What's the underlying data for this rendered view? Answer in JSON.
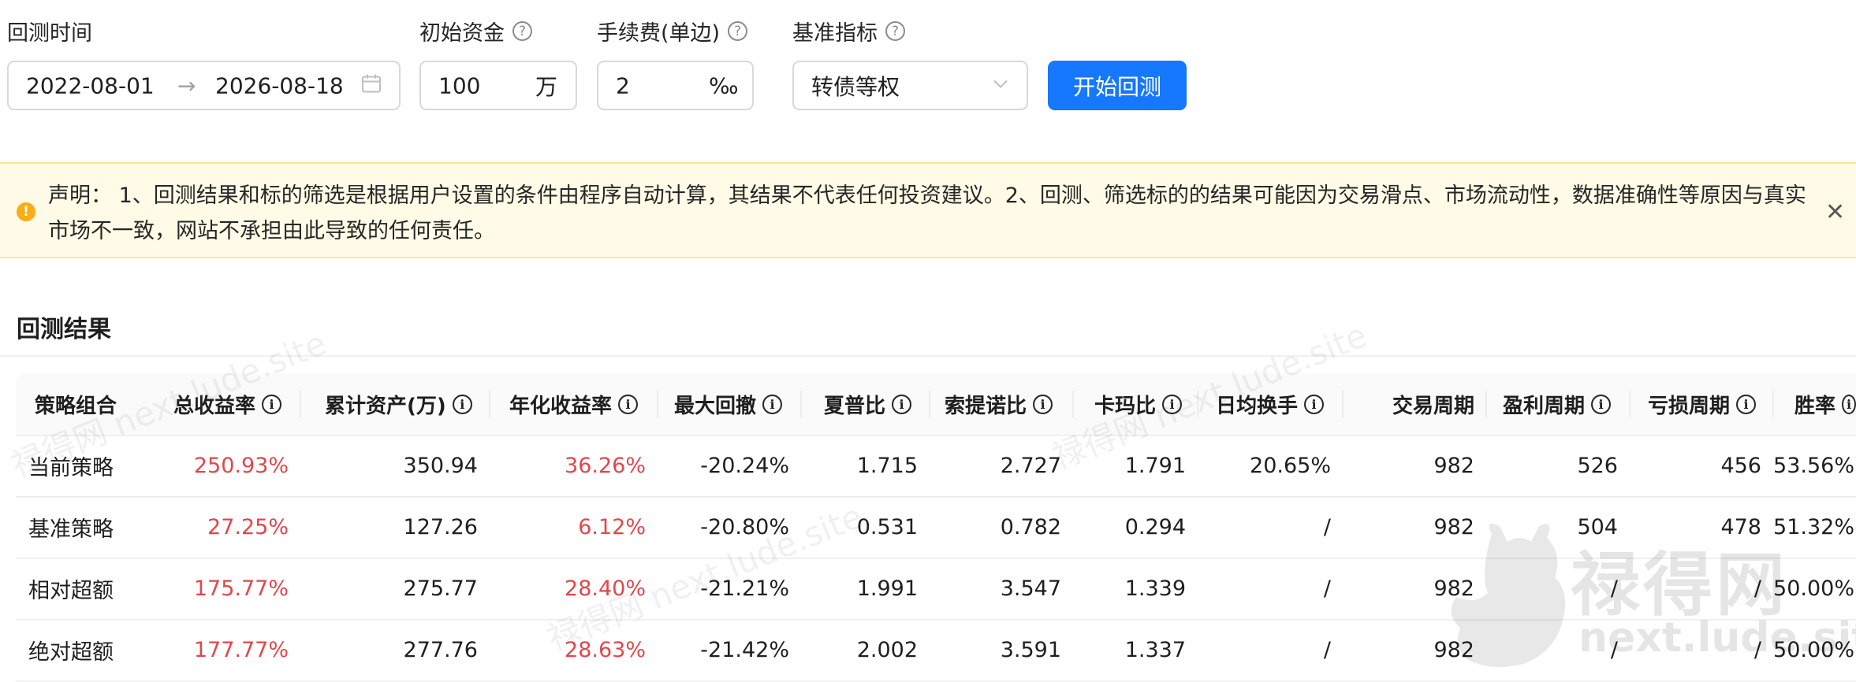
{
  "form": {
    "time_label": "回测时间",
    "capital_label": "初始资金",
    "fee_label": "手续费(单边)",
    "benchmark_label": "基准指标",
    "start_date": "2022-08-01",
    "range_arrow": "→",
    "end_date": "2026-08-18",
    "capital_value": "100",
    "capital_unit": "万",
    "fee_value": "2",
    "fee_unit": "‰",
    "benchmark_value": "转债等权",
    "run_button": "开始回测"
  },
  "notice": {
    "text": "声明： 1、回测结果和标的筛选是根据用户设置的条件由程序自动计算，其结果不代表任何投资建议。2、回测、筛选标的的结果可能因为交易滑点、市场流动性，数据准确性等原因与真实市场不一致，网站不承担由此导致的任何责任。"
  },
  "results": {
    "title": "回测结果",
    "columns": [
      "策略组合",
      "总收益率",
      "累计资产(万)",
      "年化收益率",
      "最大回撤",
      "夏普比",
      "索提诺比",
      "卡玛比",
      "日均换手",
      "交易周期",
      "盈利周期",
      "亏损周期",
      "胜率"
    ],
    "rows": [
      [
        "当前策略",
        "250.93%",
        "350.94",
        "36.26%",
        "-20.24%",
        "1.715",
        "2.727",
        "1.791",
        "20.65%",
        "982",
        "526",
        "456",
        "53.56%"
      ],
      [
        "基准策略",
        "27.25%",
        "127.26",
        "6.12%",
        "-20.80%",
        "0.531",
        "0.782",
        "0.294",
        "/",
        "982",
        "504",
        "478",
        "51.32%"
      ],
      [
        "相对超额",
        "175.77%",
        "275.77",
        "28.40%",
        "-21.21%",
        "1.991",
        "3.547",
        "1.339",
        "/",
        "982",
        "/",
        "/",
        "50.00%"
      ],
      [
        "绝对超额",
        "177.77%",
        "277.76",
        "28.63%",
        "-21.42%",
        "2.002",
        "3.591",
        "1.337",
        "/",
        "982",
        "/",
        "/",
        "50.00%"
      ]
    ]
  },
  "watermark": {
    "text": "禄得网 next.lude.site",
    "logo_text": "禄得网",
    "logo_url": "next.lude.site"
  },
  "colors": {
    "primary": "#1677ff",
    "negative_red": "#e0474c",
    "notice_bg": "#fffbe6",
    "notice_border": "#ffe58f",
    "warning": "#faad14"
  }
}
